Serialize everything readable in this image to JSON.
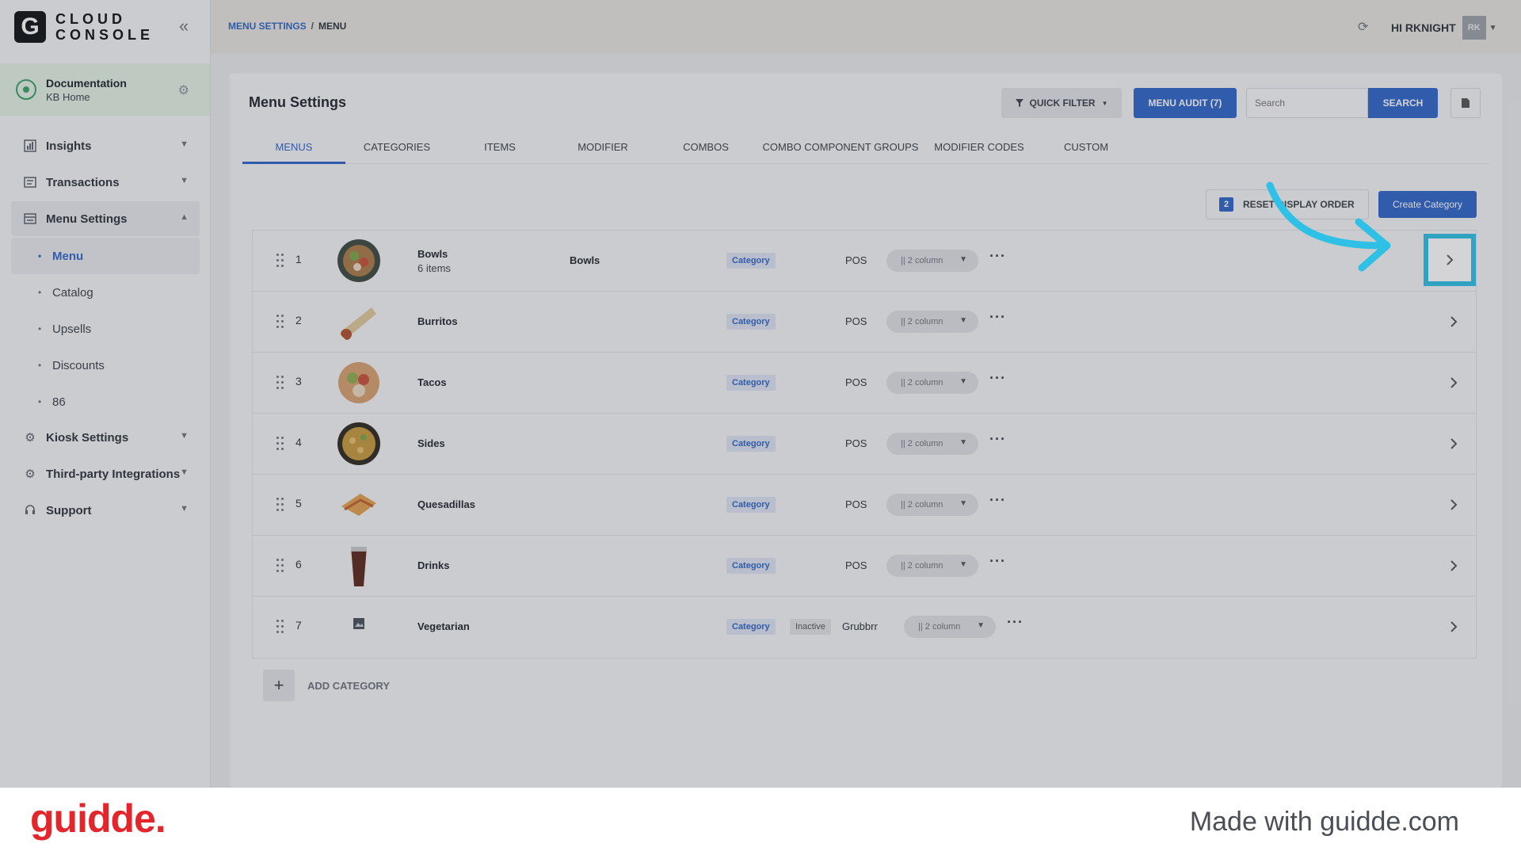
{
  "sidebar": {
    "logo_letter": "G",
    "logo_line1": "CLOUD",
    "logo_line2": "CONSOLE",
    "location": {
      "name": "Documentation",
      "sub": "KB Home"
    },
    "items": [
      {
        "label": "Insights"
      },
      {
        "label": "Transactions"
      },
      {
        "label": "Menu Settings"
      },
      {
        "label": "Kiosk Settings"
      },
      {
        "label": "Third-party Integrations"
      },
      {
        "label": "Support"
      }
    ],
    "menu_sub": [
      {
        "label": "Menu",
        "active": true
      },
      {
        "label": "Catalog"
      },
      {
        "label": "Upsells"
      },
      {
        "label": "Discounts"
      },
      {
        "label": "86"
      }
    ]
  },
  "topbar": {
    "breadcrumb_parent": "MENU SETTINGS",
    "breadcrumb_sep": "/",
    "breadcrumb_current": "MENU",
    "greeting": "HI RKNIGHT",
    "avatar": "RK"
  },
  "page": {
    "title": "Menu Settings",
    "quick_filter": "QUICK FILTER",
    "menu_audit": "MENU AUDIT (7)",
    "search_placeholder": "Search",
    "search_button": "SEARCH",
    "tabs": [
      "MENUS",
      "CATEGORIES",
      "ITEMS",
      "MODIFIER",
      "COMBOS",
      "COMBO COMPONENT GROUPS",
      "MODIFIER CODES",
      "CUSTOM"
    ],
    "reset_badge": "2",
    "reset_label": "RESET DISPLAY ORDER",
    "create_category": "Create Category",
    "add_category": "ADD CATEGORY"
  },
  "rows": [
    {
      "num": "1",
      "name": "Bowls",
      "sub": "6 items",
      "display": "Bowls",
      "tag": "Category",
      "pos": "POS",
      "layout": "|| 2 column"
    },
    {
      "num": "2",
      "name": "Burritos",
      "tag": "Category",
      "pos": "POS",
      "layout": "|| 2 column"
    },
    {
      "num": "3",
      "name": "Tacos",
      "tag": "Category",
      "pos": "POS",
      "layout": "|| 2 column"
    },
    {
      "num": "4",
      "name": "Sides",
      "tag": "Category",
      "pos": "POS",
      "layout": "|| 2 column"
    },
    {
      "num": "5",
      "name": "Quesadillas",
      "tag": "Category",
      "pos": "POS",
      "layout": "|| 2 column"
    },
    {
      "num": "6",
      "name": "Drinks",
      "tag": "Category",
      "pos": "POS",
      "layout": "|| 2 column"
    },
    {
      "num": "7",
      "name": "Vegetarian",
      "tag": "Category",
      "inactive": "Inactive",
      "pos": "Grubbrr",
      "layout": "|| 2 column"
    }
  ],
  "footer": {
    "brand": "guidde.",
    "made_with": "Made with guidde.com"
  },
  "colors": {
    "accent": "#2f66c9",
    "highlight": "#2fc0e6",
    "brand_red": "#e3262c"
  }
}
